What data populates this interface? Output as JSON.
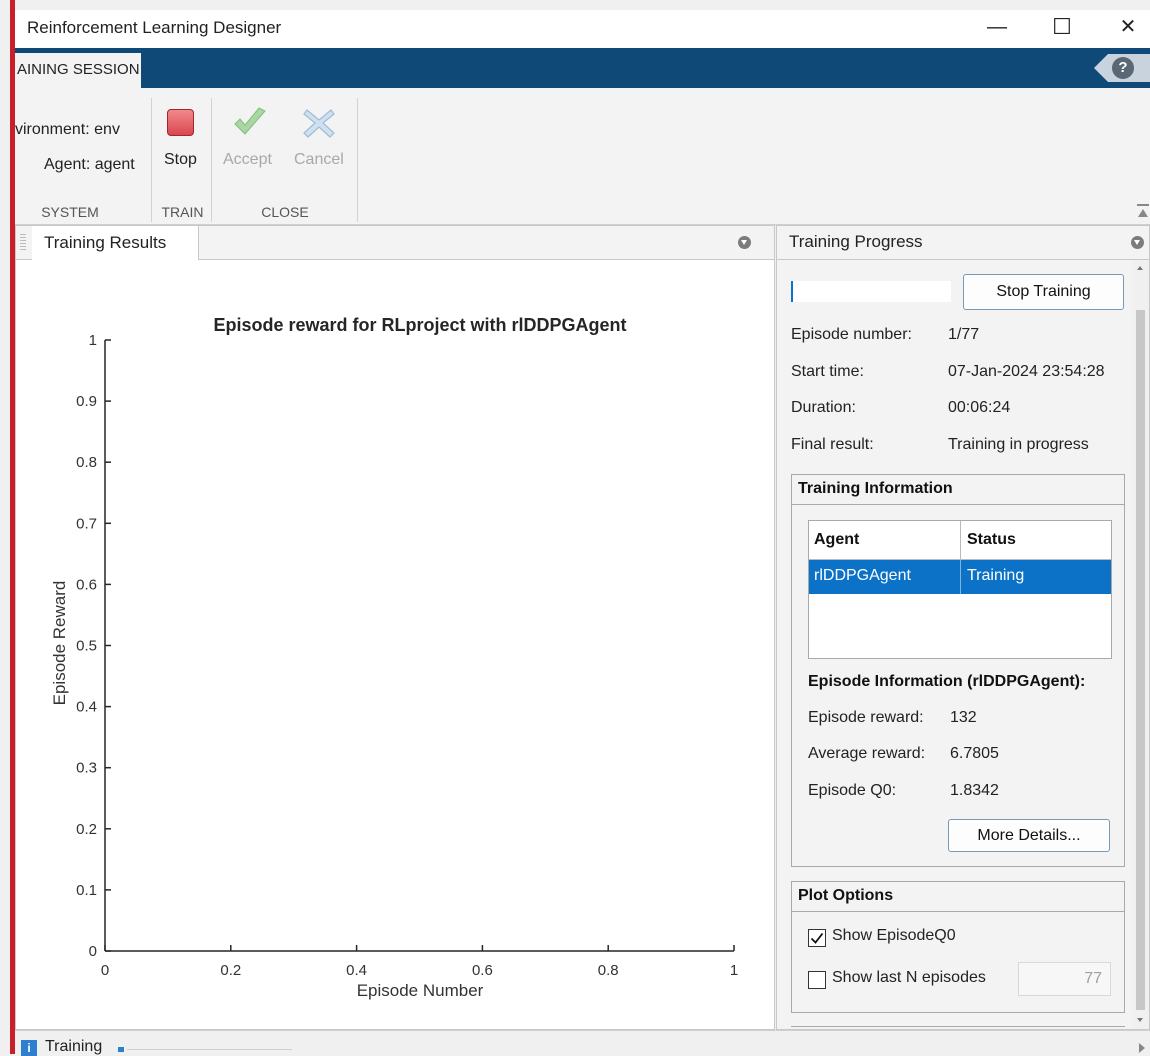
{
  "window": {
    "title": "Reinforcement Learning Designer",
    "minimize": "—",
    "maximize": "☐",
    "close": "✕"
  },
  "tabbar": {
    "active_tab": "AINING SESSION",
    "help": "?"
  },
  "ribbon": {
    "environment_label": "vironment: env",
    "agent_label": "Agent: agent",
    "stop_label": "Stop",
    "accept_label": "Accept",
    "cancel_label": "Cancel",
    "groups": {
      "system": "SYSTEM",
      "train": "TRAIN",
      "close": "CLOSE"
    }
  },
  "results_panel": {
    "tab": "Training Results"
  },
  "chart_data": {
    "type": "line",
    "title": "Episode reward for RLproject with rlDDPGAgent",
    "xlabel": "Episode Number",
    "ylabel": "Episode Reward",
    "xlim": [
      0,
      1
    ],
    "ylim": [
      0,
      1
    ],
    "xticks": [
      "0",
      "0.2",
      "0.4",
      "0.6",
      "0.8",
      "1"
    ],
    "yticks": [
      "0",
      "0.1",
      "0.2",
      "0.3",
      "0.4",
      "0.5",
      "0.6",
      "0.7",
      "0.8",
      "0.9",
      "1"
    ],
    "series": [],
    "grid": false
  },
  "progress_panel": {
    "title": "Training Progress",
    "stop_training": "Stop Training",
    "fields": [
      {
        "label": "Episode number:",
        "value": "1/77"
      },
      {
        "label": "Start time:",
        "value": "07-Jan-2024 23:54:28"
      },
      {
        "label": "Duration:",
        "value": "00:06:24"
      },
      {
        "label": "Final result:",
        "value": "Training in progress"
      }
    ],
    "training_info": {
      "title": "Training Information",
      "col_agent": "Agent",
      "col_status": "Status",
      "rows": [
        {
          "agent": "rlDDPGAgent",
          "status": "Training"
        }
      ],
      "episode_title": "Episode Information (rlDDPGAgent):",
      "episode_fields": [
        {
          "label": "Episode reward:",
          "value": "132"
        },
        {
          "label": "Average reward:",
          "value": "6.7805"
        },
        {
          "label": "Episode Q0:",
          "value": "1.8342"
        }
      ],
      "more_details": "More Details..."
    },
    "plot_options": {
      "title": "Plot Options",
      "show_q0": "Show EpisodeQ0",
      "show_q0_checked": true,
      "show_last_n": "Show last N episodes",
      "show_last_n_checked": false,
      "last_n_value": "77"
    }
  },
  "statusbar": {
    "text": "Training"
  }
}
